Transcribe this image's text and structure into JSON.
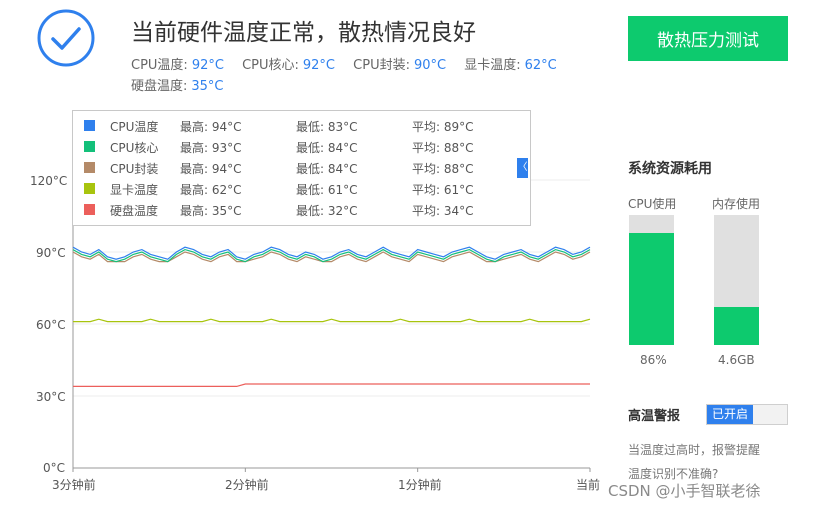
{
  "header": {
    "headline": "当前硬件温度正常，散热情况良好",
    "temps": [
      {
        "label": "CPU温度:",
        "value": "92°C"
      },
      {
        "label": "CPU核心:",
        "value": "92°C"
      },
      {
        "label": "CPU封装:",
        "value": "90°C"
      },
      {
        "label": "显卡温度:",
        "value": "62°C"
      },
      {
        "label": "硬盘温度:",
        "value": "35°C"
      }
    ],
    "stress_button": "散热压力测试",
    "status_icon": "check-circle-icon",
    "accent": "#2f80ed",
    "brand_green": "#0dca6e"
  },
  "legend": {
    "collapse_icon": "〈",
    "rows": [
      {
        "name": "CPU温度",
        "max": "最高: 94°C",
        "min": "最低: 83°C",
        "avg": "平均: 89°C",
        "color": "#2f80ed"
      },
      {
        "name": "CPU核心",
        "max": "最高: 93°C",
        "min": "最低: 84°C",
        "avg": "平均: 88°C",
        "color": "#13c07a"
      },
      {
        "name": "CPU封装",
        "max": "最高: 94°C",
        "min": "最低: 84°C",
        "avg": "平均: 88°C",
        "color": "#b48a68"
      },
      {
        "name": "显卡温度",
        "max": "最高: 62°C",
        "min": "最低: 61°C",
        "avg": "平均: 61°C",
        "color": "#a8c40e"
      },
      {
        "name": "硬盘温度",
        "max": "最高: 35°C",
        "min": "最低: 32°C",
        "avg": "平均: 34°C",
        "color": "#ec5f5b"
      }
    ]
  },
  "chart_data": {
    "type": "line",
    "y_ticks": [
      "120°C",
      "90°C",
      "60°C",
      "30°C",
      "0°C"
    ],
    "x_ticks": [
      "3分钟前",
      "2分钟前",
      "1分钟前",
      "当前"
    ],
    "ylim": [
      0,
      120
    ],
    "series": [
      {
        "name": "CPU温度",
        "color": "#2f80ed",
        "values": [
          92,
          90,
          89,
          91,
          88,
          87,
          88,
          90,
          91,
          89,
          88,
          87,
          90,
          92,
          91,
          89,
          88,
          90,
          91,
          88,
          87,
          89,
          90,
          92,
          91,
          89,
          88,
          90,
          89,
          87,
          88,
          90,
          91,
          89,
          88,
          90,
          92,
          90,
          89,
          88,
          91,
          90,
          89,
          88,
          90,
          91,
          92,
          90,
          88,
          87,
          89,
          90,
          91,
          89,
          88,
          90,
          92,
          91,
          89,
          90,
          92
        ]
      },
      {
        "name": "CPU核心",
        "color": "#13c07a",
        "values": [
          91,
          89,
          88,
          90,
          87,
          86,
          87,
          89,
          90,
          88,
          87,
          86,
          89,
          91,
          90,
          88,
          87,
          89,
          90,
          87,
          86,
          88,
          89,
          91,
          90,
          88,
          87,
          89,
          88,
          86,
          87,
          89,
          90,
          88,
          87,
          89,
          91,
          89,
          88,
          87,
          90,
          89,
          88,
          87,
          89,
          90,
          91,
          89,
          87,
          86,
          88,
          89,
          90,
          88,
          87,
          89,
          91,
          90,
          88,
          89,
          91
        ]
      },
      {
        "name": "CPU封装",
        "color": "#b48a68",
        "values": [
          90,
          88,
          87,
          89,
          86,
          86,
          86,
          88,
          89,
          87,
          86,
          86,
          88,
          90,
          89,
          87,
          86,
          88,
          89,
          86,
          86,
          87,
          88,
          90,
          89,
          87,
          86,
          88,
          87,
          86,
          86,
          88,
          89,
          87,
          86,
          88,
          90,
          88,
          87,
          86,
          89,
          88,
          87,
          86,
          88,
          89,
          90,
          88,
          86,
          86,
          87,
          88,
          89,
          87,
          86,
          88,
          90,
          89,
          87,
          88,
          90
        ]
      },
      {
        "name": "显卡温度",
        "color": "#a8c40e",
        "values": [
          61,
          61,
          61,
          62,
          61,
          61,
          61,
          61,
          61,
          62,
          61,
          61,
          61,
          61,
          61,
          61,
          62,
          61,
          61,
          61,
          61,
          61,
          61,
          62,
          61,
          61,
          61,
          61,
          61,
          61,
          62,
          61,
          61,
          61,
          61,
          61,
          61,
          61,
          62,
          61,
          61,
          61,
          61,
          61,
          61,
          61,
          62,
          61,
          61,
          61,
          61,
          61,
          61,
          62,
          61,
          61,
          61,
          61,
          61,
          61,
          62
        ]
      },
      {
        "name": "硬盘温度",
        "color": "#ec5f5b",
        "values": [
          34,
          34,
          34,
          34,
          34,
          34,
          34,
          34,
          34,
          34,
          34,
          34,
          34,
          34,
          34,
          34,
          34,
          34,
          34,
          34,
          35,
          35,
          35,
          35,
          35,
          35,
          35,
          35,
          35,
          35,
          35,
          35,
          35,
          35,
          35,
          35,
          35,
          35,
          35,
          35,
          35,
          35,
          35,
          35,
          35,
          35,
          35,
          35,
          35,
          35,
          35,
          35,
          35,
          35,
          35,
          35,
          35,
          35,
          35,
          35,
          35
        ]
      }
    ]
  },
  "resources": {
    "title": "系统资源耗用",
    "cpu": {
      "label": "CPU使用",
      "value_text": "86%",
      "fraction": 0.86
    },
    "mem": {
      "label": "内存使用",
      "value_text": "4.6GB",
      "fraction": 0.29
    }
  },
  "alarm": {
    "title": "高温警报",
    "toggle_label": "已开启",
    "hint": "当温度过高时，报警提醒",
    "help_link": "温度识别不准确?"
  },
  "watermark": "CSDN @小手智联老徐"
}
